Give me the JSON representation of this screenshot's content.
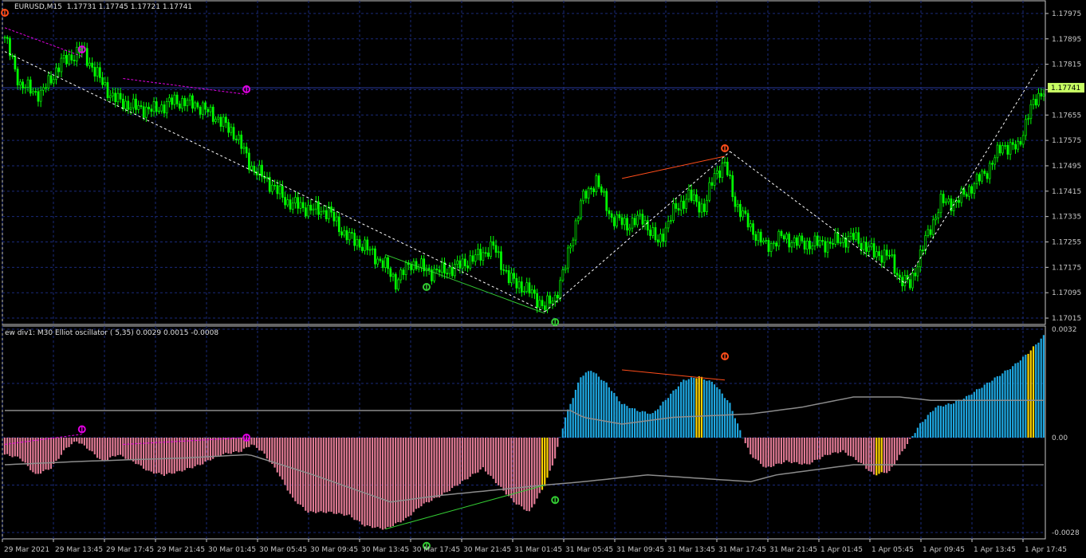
{
  "header": {
    "symbol": "EURUSD,M15",
    "ohlc": "1.17731 1.17745 1.17721 1.17741"
  },
  "indicator": {
    "title": "ew div1: M30 Elliot oscillator ( 5,35) 0.0029 0.0015 -0.0008"
  },
  "colors": {
    "background": "#000000",
    "candle": "#00ff00",
    "grid": "#1a2a7a",
    "hist_pos": "#1ea7e1",
    "hist_neg": "#e07a94",
    "hist_marker": "#ffd400",
    "signal_line": "#8c8c8c",
    "bear_div": "#ff4d1a",
    "bull_div": "#33cc33",
    "hidden_div": "#e000e0",
    "zigzag": "#ffffff",
    "price_tag": "#c8ff64"
  },
  "price_axis": {
    "labels": [
      "1.17975",
      "1.17895",
      "1.17815",
      "1.17735",
      "1.17655",
      "1.17575",
      "1.17495",
      "1.17415",
      "1.17335",
      "1.17255",
      "1.17175",
      "1.17095",
      "1.17015"
    ],
    "current": "1.17741"
  },
  "osc_axis": {
    "labels": [
      "0.0032",
      "0.00",
      "-0.0028"
    ]
  },
  "time_axis": {
    "labels": [
      "29 Mar 2021",
      "29 Mar 13:45",
      "29 Mar 17:45",
      "29 Mar 21:45",
      "30 Mar 01:45",
      "30 Mar 05:45",
      "30 Mar 09:45",
      "30 Mar 13:45",
      "30 Mar 17:45",
      "30 Mar 21:45",
      "31 Mar 01:45",
      "31 Mar 05:45",
      "31 Mar 09:45",
      "31 Mar 13:45",
      "31 Mar 17:45",
      "31 Mar 21:45",
      "1 Apr 01:45",
      "1 Apr 05:45",
      "1 Apr 09:45",
      "1 Apr 13:45",
      "1 Apr 17:45"
    ]
  },
  "chart_data": [
    {
      "type": "line",
      "title": "EURUSD,M15",
      "price_anchors": [
        [
          0,
          1.179
        ],
        [
          6,
          1.1775
        ],
        [
          14,
          1.1772
        ],
        [
          22,
          1.1782
        ],
        [
          30,
          1.1786
        ],
        [
          36,
          1.1778
        ],
        [
          42,
          1.1771
        ],
        [
          50,
          1.1768
        ],
        [
          58,
          1.1767
        ],
        [
          66,
          1.177
        ],
        [
          74,
          1.1769
        ],
        [
          82,
          1.1765
        ],
        [
          90,
          1.1759
        ],
        [
          96,
          1.1749
        ],
        [
          102,
          1.1745
        ],
        [
          110,
          1.1738
        ],
        [
          118,
          1.1736
        ],
        [
          126,
          1.1735
        ],
        [
          132,
          1.1728
        ],
        [
          140,
          1.1724
        ],
        [
          148,
          1.1718
        ],
        [
          152,
          1.1713
        ],
        [
          158,
          1.1719
        ],
        [
          166,
          1.1716
        ],
        [
          174,
          1.1717
        ],
        [
          184,
          1.1721
        ],
        [
          190,
          1.1724
        ],
        [
          196,
          1.1714
        ],
        [
          204,
          1.171
        ],
        [
          210,
          1.1705
        ],
        [
          214,
          1.1708
        ],
        [
          218,
          1.1718
        ],
        [
          224,
          1.1738
        ],
        [
          230,
          1.1745
        ],
        [
          236,
          1.1733
        ],
        [
          242,
          1.1731
        ],
        [
          248,
          1.1733
        ],
        [
          254,
          1.1725
        ],
        [
          260,
          1.1735
        ],
        [
          266,
          1.174
        ],
        [
          272,
          1.1736
        ],
        [
          276,
          1.1747
        ],
        [
          280,
          1.175
        ],
        [
          284,
          1.1738
        ],
        [
          290,
          1.173
        ],
        [
          296,
          1.1724
        ],
        [
          302,
          1.1727
        ],
        [
          310,
          1.1725
        ],
        [
          320,
          1.1725
        ],
        [
          330,
          1.1727
        ],
        [
          338,
          1.1722
        ],
        [
          344,
          1.1721
        ],
        [
          348,
          1.1714
        ],
        [
          352,
          1.1712
        ],
        [
          358,
          1.1726
        ],
        [
          364,
          1.1738
        ],
        [
          370,
          1.1738
        ],
        [
          376,
          1.1743
        ],
        [
          382,
          1.1748
        ],
        [
          388,
          1.1756
        ],
        [
          394,
          1.1755
        ],
        [
          398,
          1.1766
        ],
        [
          404,
          1.1774
        ]
      ],
      "bars": 405,
      "y_range": [
        1.16995,
        1.18015
      ]
    },
    {
      "type": "bar",
      "title": "ew div1: M30 Elliot oscillator ( 5,35) 0.0029 0.0015 -0.0008",
      "osc_anchors": [
        [
          0,
          -0.0005
        ],
        [
          6,
          -0.0006
        ],
        [
          12,
          -0.0011
        ],
        [
          18,
          -0.0009
        ],
        [
          24,
          -0.0003
        ],
        [
          28,
          -0.0001
        ],
        [
          32,
          -0.0003
        ],
        [
          38,
          -0.0007
        ],
        [
          44,
          -0.0005
        ],
        [
          50,
          -0.0007
        ],
        [
          56,
          -0.001
        ],
        [
          62,
          -0.0011
        ],
        [
          68,
          -0.001
        ],
        [
          76,
          -0.0008
        ],
        [
          84,
          -0.0005
        ],
        [
          92,
          -0.0004
        ],
        [
          96,
          -0.0002
        ],
        [
          100,
          -0.0004
        ],
        [
          106,
          -0.001
        ],
        [
          112,
          -0.0018
        ],
        [
          118,
          -0.0022
        ],
        [
          126,
          -0.0022
        ],
        [
          134,
          -0.0023
        ],
        [
          140,
          -0.0026
        ],
        [
          148,
          -0.0027
        ],
        [
          156,
          -0.0024
        ],
        [
          162,
          -0.002
        ],
        [
          170,
          -0.0017
        ],
        [
          178,
          -0.0013
        ],
        [
          186,
          -0.0009
        ],
        [
          192,
          -0.0014
        ],
        [
          198,
          -0.0019
        ],
        [
          204,
          -0.0022
        ],
        [
          210,
          -0.0014
        ],
        [
          214,
          -0.0006
        ],
        [
          218,
          0.0006
        ],
        [
          224,
          0.0018
        ],
        [
          228,
          0.002
        ],
        [
          234,
          0.0016
        ],
        [
          240,
          0.001
        ],
        [
          246,
          0.0008
        ],
        [
          252,
          0.0007
        ],
        [
          258,
          0.0012
        ],
        [
          264,
          0.0017
        ],
        [
          270,
          0.0018
        ],
        [
          276,
          0.0016
        ],
        [
          282,
          0.001
        ],
        [
          286,
          0.0002
        ],
        [
          290,
          -0.0005
        ],
        [
          296,
          -0.0009
        ],
        [
          304,
          -0.0007
        ],
        [
          312,
          -0.0008
        ],
        [
          320,
          -0.0005
        ],
        [
          326,
          -0.0004
        ],
        [
          332,
          -0.0007
        ],
        [
          338,
          -0.0011
        ],
        [
          344,
          -0.001
        ],
        [
          350,
          -0.0003
        ],
        [
          356,
          0.0004
        ],
        [
          362,
          0.0009
        ],
        [
          368,
          0.001
        ],
        [
          374,
          0.0012
        ],
        [
          380,
          0.0015
        ],
        [
          386,
          0.0018
        ],
        [
          392,
          0.0021
        ],
        [
          398,
          0.0025
        ],
        [
          404,
          0.003
        ]
      ],
      "signal_anchors": [
        [
          0,
          0.0008
        ],
        [
          30,
          0.0008
        ],
        [
          60,
          0.0008
        ],
        [
          120,
          0.0008
        ],
        [
          150,
          0.0008
        ],
        [
          200,
          0.0008
        ],
        [
          220,
          0.0008
        ],
        [
          225,
          0.0006
        ],
        [
          240,
          0.0004
        ],
        [
          260,
          0.0006
        ],
        [
          290,
          0.0007
        ],
        [
          310,
          0.0009
        ],
        [
          330,
          0.0012
        ],
        [
          348,
          0.0012
        ],
        [
          360,
          0.0011
        ],
        [
          380,
          0.0011
        ],
        [
          404,
          0.0011
        ]
      ],
      "signal2_anchors": [
        [
          0,
          -0.0008
        ],
        [
          30,
          -0.0007
        ],
        [
          70,
          -0.0006
        ],
        [
          95,
          -0.0005
        ],
        [
          120,
          -0.0011
        ],
        [
          150,
          -0.0019
        ],
        [
          170,
          -0.0017
        ],
        [
          210,
          -0.0014
        ],
        [
          225,
          -0.0013
        ],
        [
          250,
          -0.0011
        ],
        [
          290,
          -0.0013
        ],
        [
          300,
          -0.0011
        ],
        [
          330,
          -0.0008
        ],
        [
          350,
          -0.0008
        ],
        [
          404,
          -0.0008
        ]
      ],
      "highlight_bars": [
        210,
        270,
        340,
        399
      ],
      "y_range": [
        -0.0028,
        0.0032
      ]
    }
  ]
}
